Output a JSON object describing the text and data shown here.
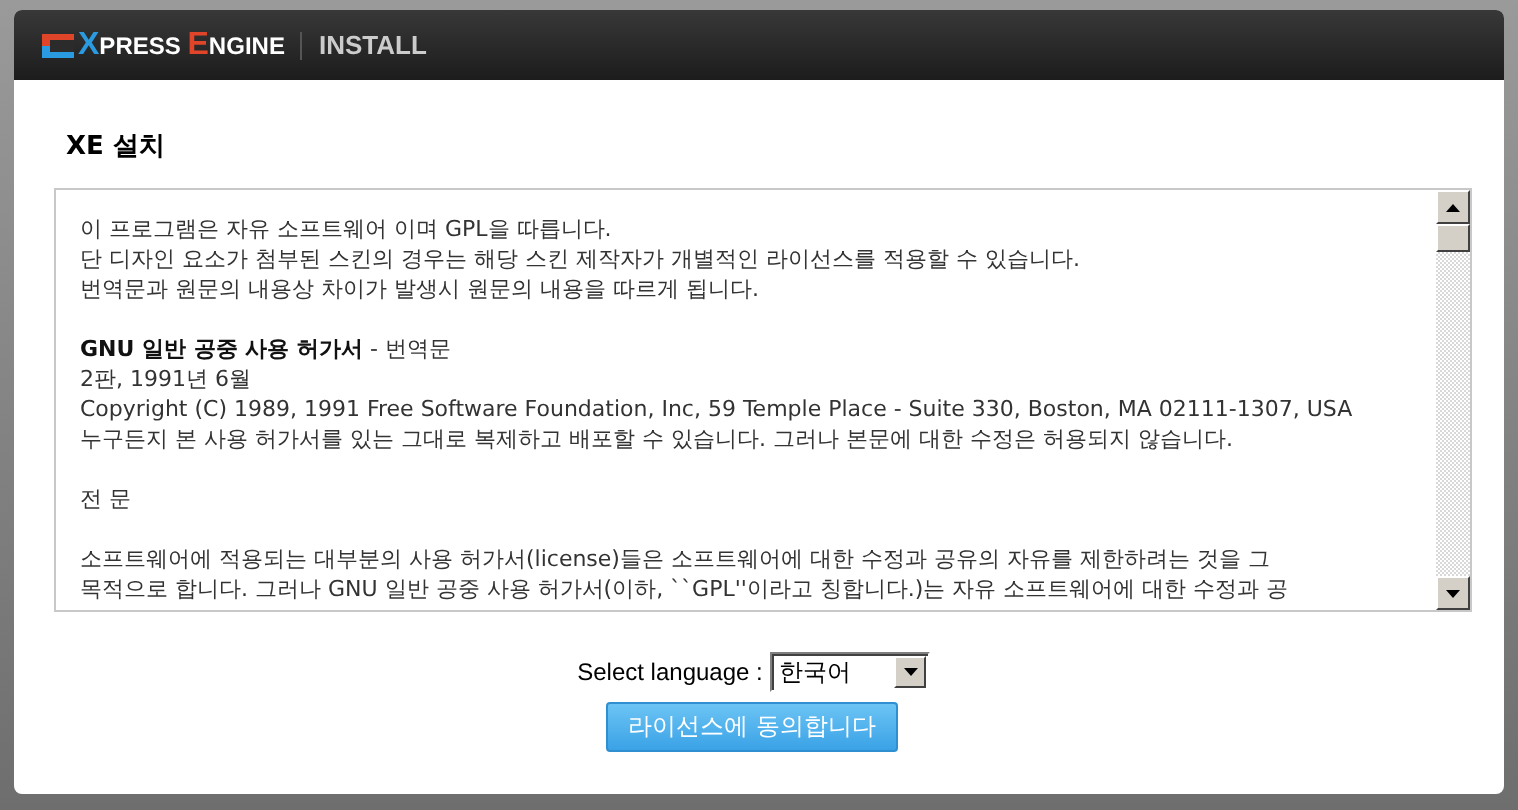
{
  "header": {
    "logo": "XPRESS ENGINE",
    "section": "INSTALL"
  },
  "title": "XE 설치",
  "license": {
    "paragraphs": [
      [
        "이 프로그램은 자유 소프트웨어 이며 GPL을 따릅니다.",
        "단 디자인 요소가 첨부된 스킨의 경우는 해당 스킨 제작자가 개별적인 라이선스를 적용할 수 있습니다.",
        "번역문과 원문의 내용상 차이가 발생시 원문의 내용을 따르게 됩니다."
      ],
      [
        "**GNU 일반 공중 사용 허가서** - 번역문",
        "2판, 1991년 6월",
        "Copyright (C) 1989, 1991 Free Software Foundation, Inc, 59 Temple Place - Suite 330, Boston, MA 02111-1307, USA",
        "누구든지 본 사용 허가서를 있는 그대로 복제하고 배포할 수 있습니다. 그러나 본문에 대한 수정은 허용되지 않습니다."
      ],
      [
        "전 문"
      ],
      [
        "소프트웨어에 적용되는 대부분의 사용 허가서(license)들은 소프트웨어에 대한 수정과 공유의 자유를 제한하려는 것을 그",
        "목적으로 합니다. 그러나 GNU 일반 공중 사용 허가서(이하, ``GPL''이라고 칭합니다.)는 자유 소프트웨어에 대한 수정과 공"
      ]
    ]
  },
  "language": {
    "label": "Select language :",
    "value": "한국어"
  },
  "agree_button": "라이선스에 동의합니다"
}
